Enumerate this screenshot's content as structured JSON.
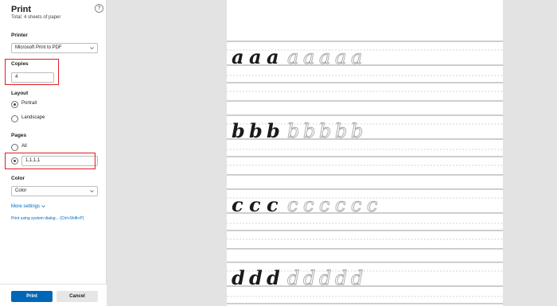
{
  "dialog": {
    "title": "Print",
    "subtitle": "Total: 4 sheets of paper",
    "help_label": "?"
  },
  "printer": {
    "label": "Printer",
    "value": "Microsoft Print to PDF"
  },
  "copies": {
    "label": "Copies",
    "value": "4"
  },
  "layout": {
    "label": "Layout",
    "options": [
      "Portrait",
      "Landscape"
    ],
    "selected": "Portrait"
  },
  "pages": {
    "label": "Pages",
    "options": [
      "All"
    ],
    "custom_value": "1,1,1,1"
  },
  "color": {
    "label": "Color",
    "value": "Color"
  },
  "links": {
    "more_settings": "More settings",
    "system_dialog": "Print using system dialog... (Ctrl+Shift+P)"
  },
  "buttons": {
    "print": "Print",
    "cancel": "Cancel"
  },
  "theme": {
    "accent": "#0067b8",
    "highlight": "#e41b23",
    "preview_bg": "#e3e3e3"
  },
  "preview": {
    "rows": [
      {
        "letter": "a",
        "traced": 3,
        "ghost": 5
      },
      {
        "letter": "b",
        "traced": 3,
        "ghost": 5
      },
      {
        "letter": "c",
        "traced": 3,
        "ghost": 6
      },
      {
        "letter": "d",
        "traced": 3,
        "ghost": 5
      }
    ]
  }
}
